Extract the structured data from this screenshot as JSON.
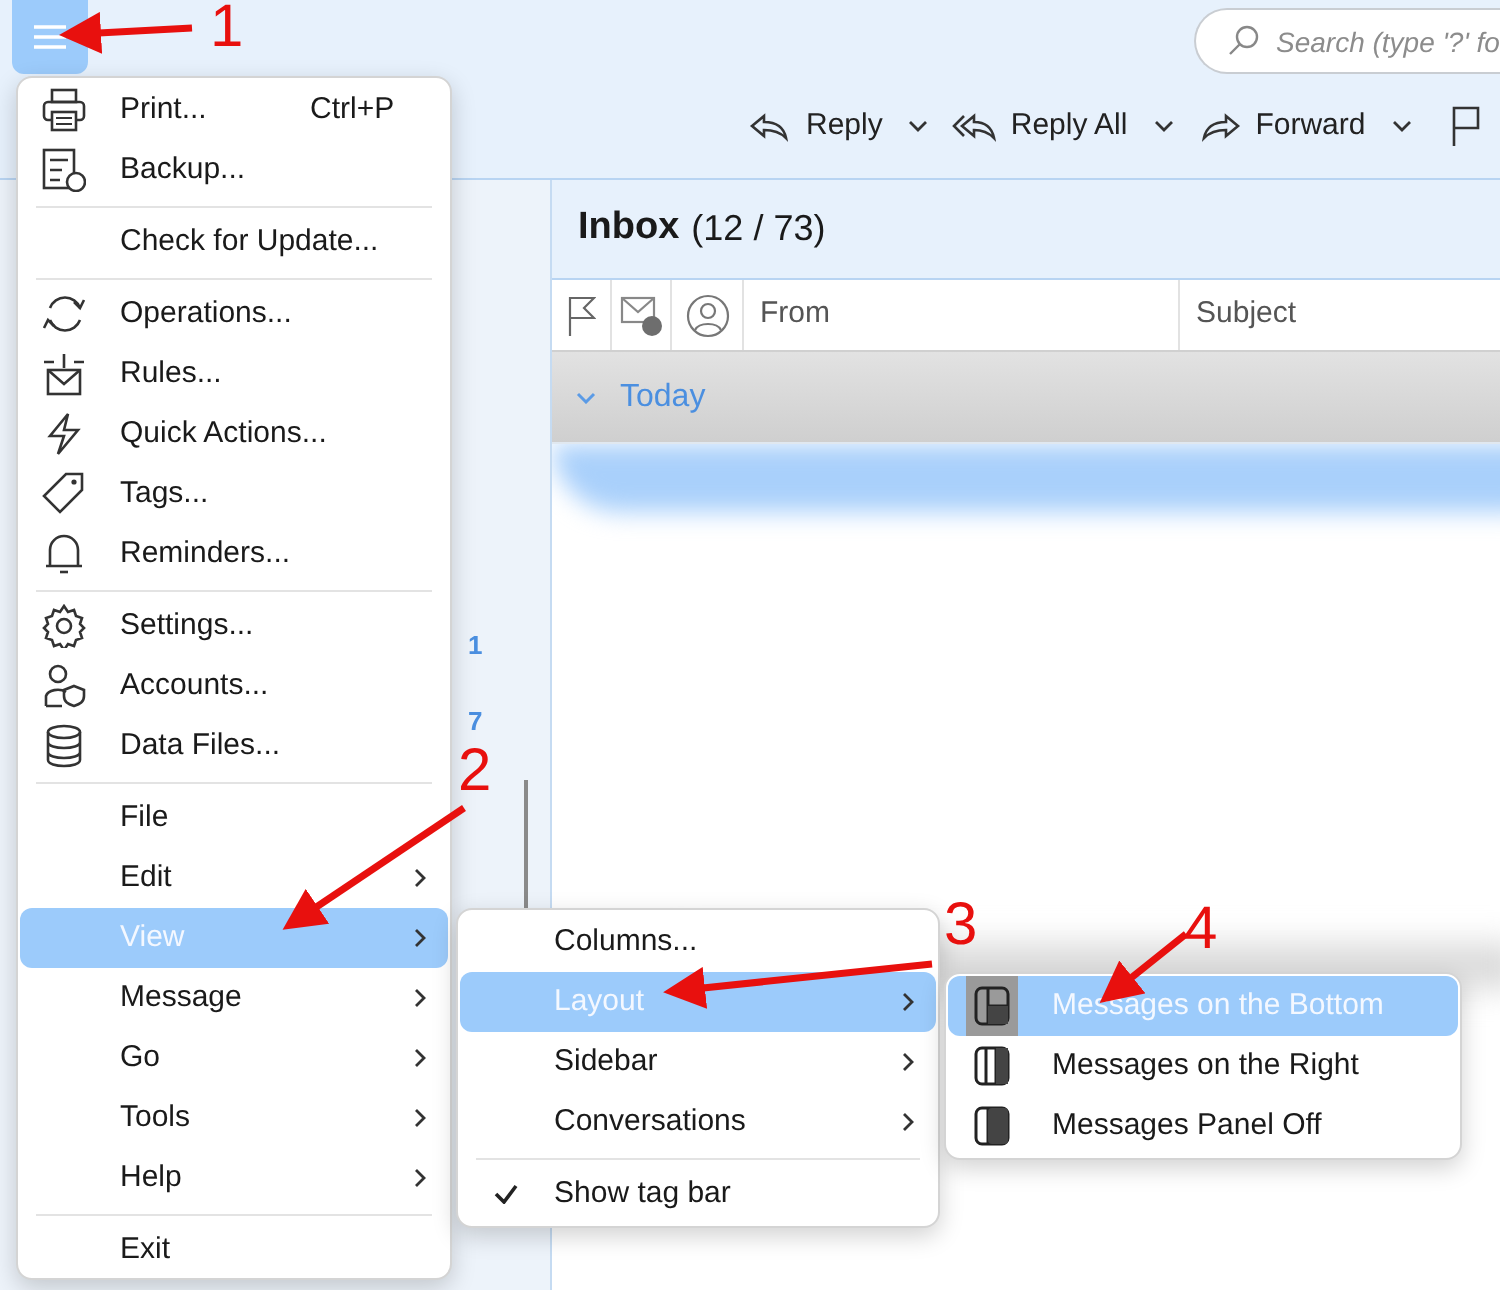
{
  "toolbar": {
    "search": {
      "placeholder": "Search (type '?' fo"
    },
    "actions": [
      {
        "label": "Reply"
      },
      {
        "label": "Reply All"
      },
      {
        "label": "Forward"
      }
    ]
  },
  "sidebar": {
    "counts": [
      "1",
      "7"
    ]
  },
  "message_list": {
    "title": "Inbox",
    "count": "(12 / 73)",
    "columns": [
      {
        "kind": "flag"
      },
      {
        "kind": "read"
      },
      {
        "kind": "contact"
      },
      {
        "kind": "text",
        "label": "From"
      },
      {
        "kind": "text",
        "label": "Subject"
      }
    ],
    "group": "Today"
  },
  "main_menu": {
    "sections": [
      [
        {
          "label": "Print...",
          "shortcut": "Ctrl+P",
          "submenu": false,
          "selected": false
        },
        {
          "label": "Backup...",
          "submenu": false,
          "selected": false
        }
      ],
      [
        {
          "label": "Check for Update...",
          "submenu": false,
          "selected": false
        }
      ],
      [
        {
          "label": "Operations...",
          "submenu": false,
          "selected": false
        },
        {
          "label": "Rules...",
          "submenu": false,
          "selected": false
        },
        {
          "label": "Quick Actions...",
          "submenu": false,
          "selected": false
        },
        {
          "label": "Tags...",
          "submenu": false,
          "selected": false
        },
        {
          "label": "Reminders...",
          "submenu": false,
          "selected": false
        }
      ],
      [
        {
          "label": "Settings...",
          "submenu": false,
          "selected": false
        },
        {
          "label": "Accounts...",
          "submenu": false,
          "selected": false
        },
        {
          "label": "Data Files...",
          "submenu": false,
          "selected": false
        }
      ],
      [
        {
          "label": "File",
          "submenu": false,
          "selected": false
        },
        {
          "label": "Edit",
          "submenu": true,
          "selected": false
        },
        {
          "label": "View",
          "submenu": true,
          "selected": true
        },
        {
          "label": "Message",
          "submenu": true,
          "selected": false
        },
        {
          "label": "Go",
          "submenu": true,
          "selected": false
        },
        {
          "label": "Tools",
          "submenu": true,
          "selected": false
        },
        {
          "label": "Help",
          "submenu": true,
          "selected": false
        }
      ],
      [
        {
          "label": "Exit",
          "submenu": false,
          "selected": false
        }
      ]
    ]
  },
  "view_menu": {
    "sections": [
      [
        {
          "label": "Columns...",
          "submenu": false,
          "selected": false,
          "checked": false
        },
        {
          "label": "Layout",
          "submenu": true,
          "selected": true,
          "checked": false
        },
        {
          "label": "Sidebar",
          "submenu": true,
          "selected": false,
          "checked": false
        },
        {
          "label": "Conversations",
          "submenu": true,
          "selected": false,
          "checked": false
        }
      ],
      [
        {
          "label": "Show tag bar",
          "submenu": false,
          "selected": false,
          "checked": true
        }
      ]
    ]
  },
  "layout_menu": {
    "items": [
      {
        "kind": "bottom",
        "label": "Messages on the Bottom",
        "selected": true
      },
      {
        "kind": "right",
        "label": "Messages on the Right",
        "selected": false
      },
      {
        "kind": "off",
        "label": "Messages Panel Off",
        "selected": false
      }
    ]
  },
  "annotations": [
    {
      "label": "1"
    },
    {
      "label": "2"
    },
    {
      "label": "3"
    },
    {
      "label": "4"
    }
  ]
}
